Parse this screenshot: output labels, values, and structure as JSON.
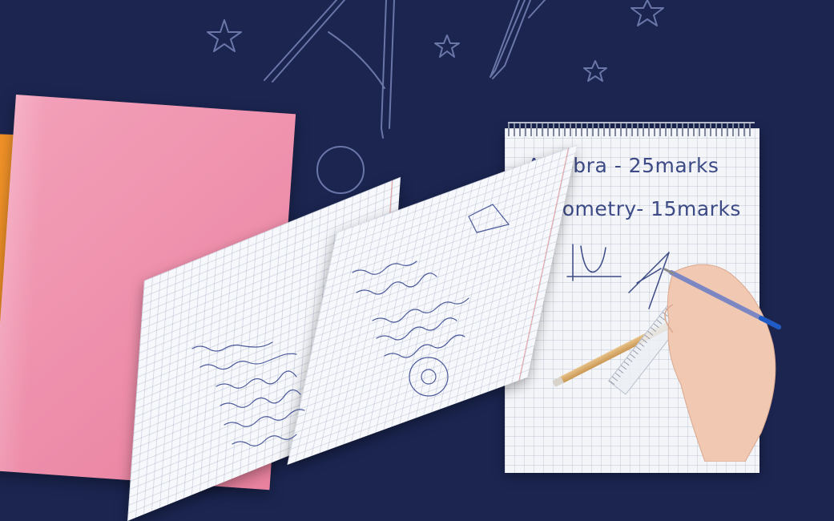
{
  "spiral_pad": {
    "line_1": "Algebra - 25marks",
    "line_2": "Geometry- 15marks"
  },
  "colors": {
    "background": "#1b2550",
    "doodle_stroke": "#6a76a8",
    "pad_ink": "#3c4a86",
    "pink_notebook": "#ef93af",
    "orange_notebook": "#f39a2c"
  },
  "icons": [
    "star-icon",
    "compass-icon",
    "pen-icon",
    "circle-icon",
    "pencil-icon",
    "ruler-icon",
    "hand-icon"
  ]
}
